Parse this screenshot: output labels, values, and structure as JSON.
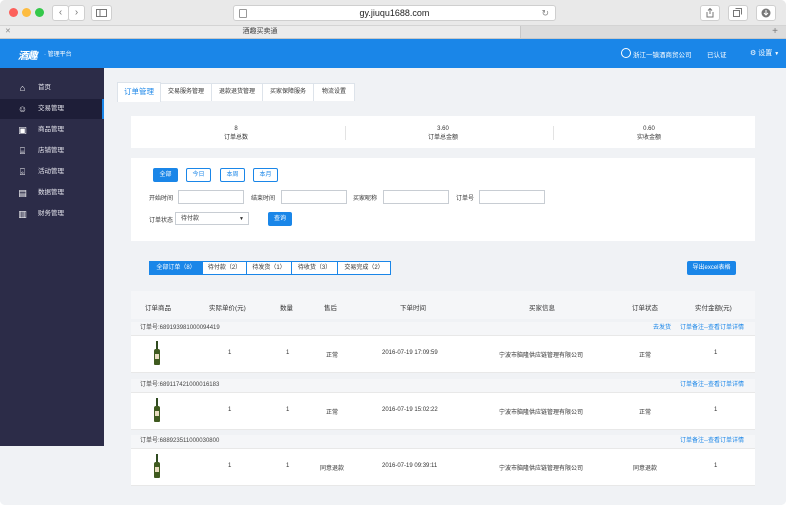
{
  "browser": {
    "url": "gy.jiuqu1688.com",
    "tab_title": "酒趣买卖通",
    "back_icon": "‹",
    "forward_icon": "›"
  },
  "header": {
    "logo": "酒趣",
    "subtitle": "· 管理平台",
    "shop_name": "浙江一镇酒商贸公司",
    "verified": "已认证",
    "settings": "设置"
  },
  "sidebar": {
    "items": [
      {
        "label": "首页",
        "icon": "⌂"
      },
      {
        "label": "交易管理",
        "icon": "☺"
      },
      {
        "label": "商品管理",
        "icon": "▣"
      },
      {
        "label": "店铺管理",
        "icon": "⌸"
      },
      {
        "label": "活动管理",
        "icon": "⌺"
      },
      {
        "label": "数据管理",
        "icon": "▤"
      },
      {
        "label": "财务管理",
        "icon": "▥"
      }
    ]
  },
  "tabs": [
    "订单管理",
    "交易服务管理",
    "退款退货管理",
    "买家保障服务",
    "物流设置"
  ],
  "stats": [
    {
      "value": "8",
      "label": "订单总数"
    },
    {
      "value": "3.60",
      "label": "订单总金额"
    },
    {
      "value": "0.60",
      "label": "实收金额"
    }
  ],
  "quick_filters": [
    "全部",
    "今日",
    "本周",
    "本月"
  ],
  "search": {
    "start_time": "开始时间",
    "end_time": "结束时间",
    "buyer_name": "买家昵称",
    "order_no": "订单号",
    "status_label": "订单状态",
    "status_value": "待付款",
    "query_button": "查询"
  },
  "status_filters": [
    "全部订单（8）",
    "待付款（2）",
    "待发货（1）",
    "待收货（3）",
    "交易完成（2）"
  ],
  "export_button": "导出excel表格",
  "table": {
    "headers": [
      "订单商品",
      "实际单价(元)",
      "数量",
      "售后",
      "下单时间",
      "买家信息",
      "订单状态",
      "实付金额(元)"
    ],
    "orders": [
      {
        "order_id": "订单号:689193981000094419",
        "ship_link": "去发货",
        "actions": "订单备注--查看订单详情",
        "price": "1",
        "qty": "1",
        "after_sale": "正常",
        "time": "2016-07-19 17:09:59",
        "buyer": "宁波市脑隆供应链管理有限公司",
        "status": "正常",
        "paid": "1"
      },
      {
        "order_id": "订单号:689117421000016183",
        "ship_link": "",
        "actions": "订单备注--查看订单详情",
        "price": "1",
        "qty": "1",
        "after_sale": "正常",
        "time": "2016-07-19 15:02:22",
        "buyer": "宁波市脑隆供应链管理有限公司",
        "status": "正常",
        "paid": "1"
      },
      {
        "order_id": "订单号:688923511000030800",
        "ship_link": "",
        "actions": "订单备注--查看订单详情",
        "price": "1",
        "qty": "1",
        "after_sale": "同意退款",
        "time": "2016-07-19 09:39:11",
        "buyer": "宁波市脑隆供应链管理有限公司",
        "status": "同意退款",
        "paid": "1"
      }
    ]
  }
}
